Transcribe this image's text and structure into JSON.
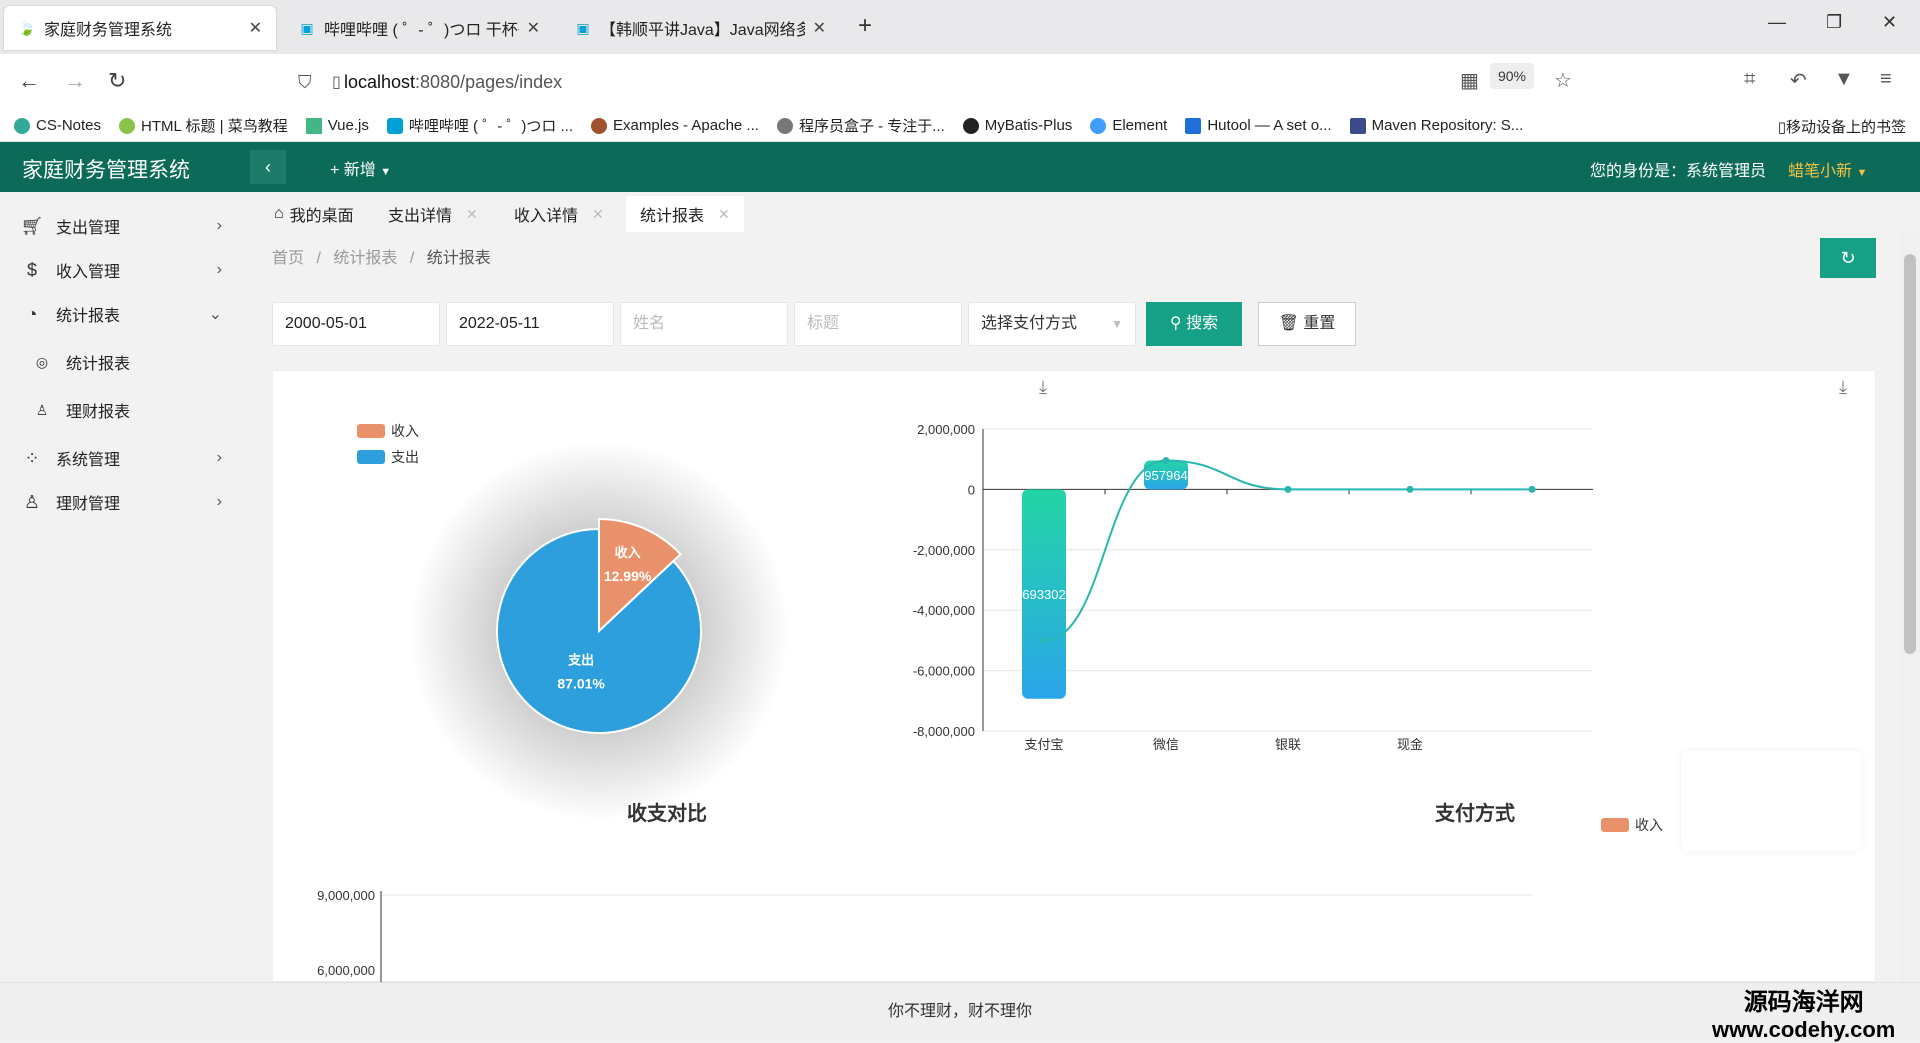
{
  "browser": {
    "tabs": [
      {
        "title": "家庭财务管理系统",
        "icon": "leaf-icon"
      },
      {
        "title": "哔哩哔哩 ( ゜- ゜)つロ 干杯~-bili",
        "icon": "bilibili-icon"
      },
      {
        "title": "【韩顺平讲Java】Java网络多线",
        "icon": "bilibili-icon"
      }
    ],
    "url_host": "localhost",
    "url_rest": ":8080/pages/index",
    "zoom": "90%",
    "bookmarks": [
      "CS-Notes",
      "HTML 标题 | 菜鸟教程",
      "Vue.js",
      "哔哩哔哩 ( ゜- ゜)つロ ...",
      "Examples - Apache ...",
      "程序员盒子 - 专注于...",
      "MyBatis-Plus",
      "Element",
      "Hutool — A set o...",
      "Maven Repository: S..."
    ],
    "mobile_bookmarks": "移动设备上的书签"
  },
  "app": {
    "title": "家庭财务管理系统",
    "add_label": "+ 新增",
    "identity": "您的身份是：系统管理员",
    "username": "蜡笔小新"
  },
  "sidebar": [
    {
      "label": "支出管理",
      "icon": "cart-icon"
    },
    {
      "label": "收入管理",
      "icon": "dollar-icon"
    },
    {
      "label": "统计报表",
      "icon": "dashboard-icon"
    },
    {
      "label": "统计报表",
      "icon": "gauge-icon"
    },
    {
      "label": "理财报表",
      "icon": "user-icon"
    },
    {
      "label": "系统管理",
      "icon": "grid-icon"
    },
    {
      "label": "理财管理",
      "icon": "person-icon"
    }
  ],
  "page_tabs": [
    "我的桌面",
    "支出详情",
    "收入详情",
    "统计报表"
  ],
  "breadcrumb": {
    "home": "首页",
    "parent": "统计报表",
    "current": "统计报表"
  },
  "filters": {
    "start_date": "2000-05-01",
    "end_date": "2022-05-11",
    "name_placeholder": "姓名",
    "title_placeholder": "标题",
    "pay_method": "选择支付方式",
    "search_label": "搜索",
    "reset_label": "重置"
  },
  "chart_data": [
    {
      "type": "pie",
      "title": "收支对比",
      "legend": [
        "收入",
        "支出"
      ],
      "legend_position": "top-left",
      "slices": [
        {
          "name": "收入",
          "percent": 12.99,
          "label": "12.99%",
          "color": "#e8916a"
        },
        {
          "name": "支出",
          "percent": 87.01,
          "label": "87.01%",
          "color": "#2e9fdd"
        }
      ]
    },
    {
      "type": "bar",
      "title": "支付方式",
      "categories": [
        "支付宝",
        "微信",
        "银联",
        "现金",
        ""
      ],
      "ylim": [
        -8000000,
        2000000
      ],
      "yticks": [
        2000000,
        0,
        -2000000,
        -4000000,
        -6000000,
        -8000000
      ],
      "ytick_labels": [
        "2,000,000",
        "0",
        "-2,000,000",
        "-4,000,000",
        "-6,000,000",
        "-8,000,000"
      ],
      "legend": [
        "收入",
        ""
      ],
      "legend_position": "bottom-right",
      "series": [
        {
          "name": "收入",
          "values": [
            -6933020,
            957964,
            0,
            0,
            0
          ],
          "labels": [
            "693302",
            "957964",
            "",
            "",
            ""
          ]
        }
      ],
      "line_values": [
        -5000000,
        957964,
        0,
        0,
        0
      ]
    },
    {
      "type": "bar",
      "title": "",
      "ytick_labels": [
        "9,000,000",
        "6,000,000"
      ]
    }
  ],
  "footer": "你不理财，财不理你",
  "watermark": {
    "line1": "源码海洋网",
    "line2": "www.codehy.com"
  }
}
